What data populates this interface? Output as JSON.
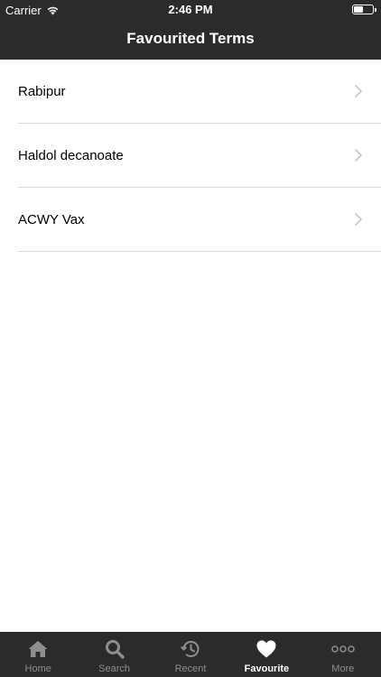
{
  "status_bar": {
    "carrier": "Carrier",
    "time": "2:46 PM"
  },
  "nav": {
    "title": "Favourited Terms"
  },
  "favourites": [
    {
      "label": "Rabipur"
    },
    {
      "label": "Haldol decanoate"
    },
    {
      "label": "ACWY Vax"
    }
  ],
  "tabs": [
    {
      "label": "Home",
      "icon": "home-icon"
    },
    {
      "label": "Search",
      "icon": "search-icon"
    },
    {
      "label": "Recent",
      "icon": "history-icon"
    },
    {
      "label": "Favourite",
      "icon": "heart-icon",
      "active": true
    },
    {
      "label": "More",
      "icon": "more-icon"
    }
  ],
  "colors": {
    "bar_background": "#2b2b2b",
    "active_tab": "#ffffff",
    "inactive_tab": "#8e8e8e",
    "separator": "#d9d9d9",
    "chevron": "#c7c7cc"
  }
}
